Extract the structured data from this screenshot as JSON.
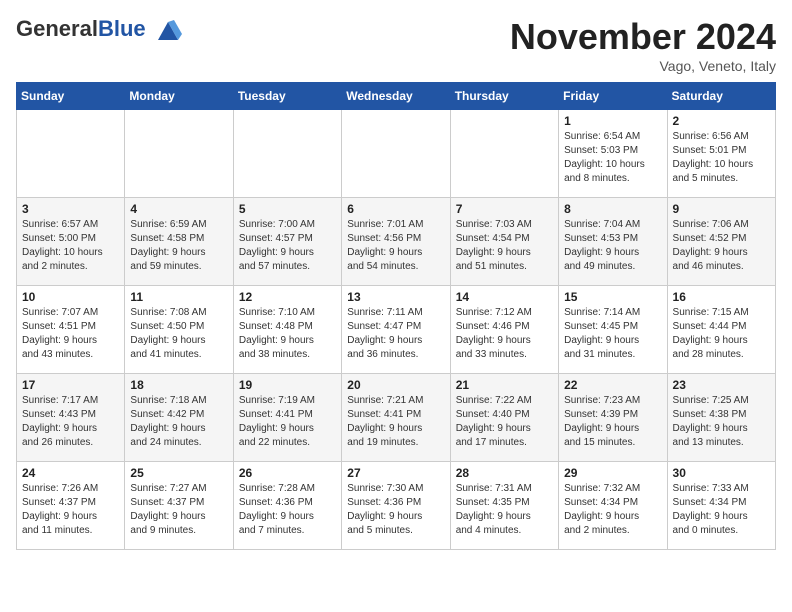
{
  "header": {
    "logo_general": "General",
    "logo_blue": "Blue",
    "month_title": "November 2024",
    "location": "Vago, Veneto, Italy"
  },
  "weekdays": [
    "Sunday",
    "Monday",
    "Tuesday",
    "Wednesday",
    "Thursday",
    "Friday",
    "Saturday"
  ],
  "weeks": [
    [
      {
        "day": "",
        "info": ""
      },
      {
        "day": "",
        "info": ""
      },
      {
        "day": "",
        "info": ""
      },
      {
        "day": "",
        "info": ""
      },
      {
        "day": "",
        "info": ""
      },
      {
        "day": "1",
        "info": "Sunrise: 6:54 AM\nSunset: 5:03 PM\nDaylight: 10 hours\nand 8 minutes."
      },
      {
        "day": "2",
        "info": "Sunrise: 6:56 AM\nSunset: 5:01 PM\nDaylight: 10 hours\nand 5 minutes."
      }
    ],
    [
      {
        "day": "3",
        "info": "Sunrise: 6:57 AM\nSunset: 5:00 PM\nDaylight: 10 hours\nand 2 minutes."
      },
      {
        "day": "4",
        "info": "Sunrise: 6:59 AM\nSunset: 4:58 PM\nDaylight: 9 hours\nand 59 minutes."
      },
      {
        "day": "5",
        "info": "Sunrise: 7:00 AM\nSunset: 4:57 PM\nDaylight: 9 hours\nand 57 minutes."
      },
      {
        "day": "6",
        "info": "Sunrise: 7:01 AM\nSunset: 4:56 PM\nDaylight: 9 hours\nand 54 minutes."
      },
      {
        "day": "7",
        "info": "Sunrise: 7:03 AM\nSunset: 4:54 PM\nDaylight: 9 hours\nand 51 minutes."
      },
      {
        "day": "8",
        "info": "Sunrise: 7:04 AM\nSunset: 4:53 PM\nDaylight: 9 hours\nand 49 minutes."
      },
      {
        "day": "9",
        "info": "Sunrise: 7:06 AM\nSunset: 4:52 PM\nDaylight: 9 hours\nand 46 minutes."
      }
    ],
    [
      {
        "day": "10",
        "info": "Sunrise: 7:07 AM\nSunset: 4:51 PM\nDaylight: 9 hours\nand 43 minutes."
      },
      {
        "day": "11",
        "info": "Sunrise: 7:08 AM\nSunset: 4:50 PM\nDaylight: 9 hours\nand 41 minutes."
      },
      {
        "day": "12",
        "info": "Sunrise: 7:10 AM\nSunset: 4:48 PM\nDaylight: 9 hours\nand 38 minutes."
      },
      {
        "day": "13",
        "info": "Sunrise: 7:11 AM\nSunset: 4:47 PM\nDaylight: 9 hours\nand 36 minutes."
      },
      {
        "day": "14",
        "info": "Sunrise: 7:12 AM\nSunset: 4:46 PM\nDaylight: 9 hours\nand 33 minutes."
      },
      {
        "day": "15",
        "info": "Sunrise: 7:14 AM\nSunset: 4:45 PM\nDaylight: 9 hours\nand 31 minutes."
      },
      {
        "day": "16",
        "info": "Sunrise: 7:15 AM\nSunset: 4:44 PM\nDaylight: 9 hours\nand 28 minutes."
      }
    ],
    [
      {
        "day": "17",
        "info": "Sunrise: 7:17 AM\nSunset: 4:43 PM\nDaylight: 9 hours\nand 26 minutes."
      },
      {
        "day": "18",
        "info": "Sunrise: 7:18 AM\nSunset: 4:42 PM\nDaylight: 9 hours\nand 24 minutes."
      },
      {
        "day": "19",
        "info": "Sunrise: 7:19 AM\nSunset: 4:41 PM\nDaylight: 9 hours\nand 22 minutes."
      },
      {
        "day": "20",
        "info": "Sunrise: 7:21 AM\nSunset: 4:41 PM\nDaylight: 9 hours\nand 19 minutes."
      },
      {
        "day": "21",
        "info": "Sunrise: 7:22 AM\nSunset: 4:40 PM\nDaylight: 9 hours\nand 17 minutes."
      },
      {
        "day": "22",
        "info": "Sunrise: 7:23 AM\nSunset: 4:39 PM\nDaylight: 9 hours\nand 15 minutes."
      },
      {
        "day": "23",
        "info": "Sunrise: 7:25 AM\nSunset: 4:38 PM\nDaylight: 9 hours\nand 13 minutes."
      }
    ],
    [
      {
        "day": "24",
        "info": "Sunrise: 7:26 AM\nSunset: 4:37 PM\nDaylight: 9 hours\nand 11 minutes."
      },
      {
        "day": "25",
        "info": "Sunrise: 7:27 AM\nSunset: 4:37 PM\nDaylight: 9 hours\nand 9 minutes."
      },
      {
        "day": "26",
        "info": "Sunrise: 7:28 AM\nSunset: 4:36 PM\nDaylight: 9 hours\nand 7 minutes."
      },
      {
        "day": "27",
        "info": "Sunrise: 7:30 AM\nSunset: 4:36 PM\nDaylight: 9 hours\nand 5 minutes."
      },
      {
        "day": "28",
        "info": "Sunrise: 7:31 AM\nSunset: 4:35 PM\nDaylight: 9 hours\nand 4 minutes."
      },
      {
        "day": "29",
        "info": "Sunrise: 7:32 AM\nSunset: 4:34 PM\nDaylight: 9 hours\nand 2 minutes."
      },
      {
        "day": "30",
        "info": "Sunrise: 7:33 AM\nSunset: 4:34 PM\nDaylight: 9 hours\nand 0 minutes."
      }
    ]
  ]
}
